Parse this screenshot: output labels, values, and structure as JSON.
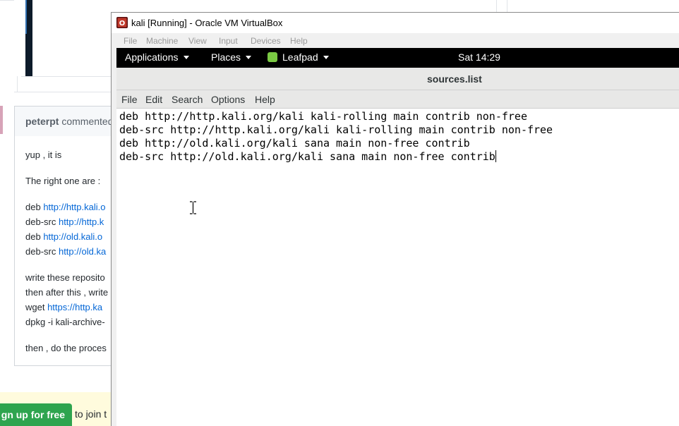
{
  "background_page": {
    "comment": {
      "author": "peterpt",
      "action": "commented",
      "lines": [
        {
          "text": "yup , it is",
          "link": ""
        },
        {
          "text": "The right one are :",
          "link": ""
        },
        {
          "text": "deb ",
          "link": "http://http.kali.o"
        },
        {
          "text": "deb-src ",
          "link": "http://http.k"
        },
        {
          "text": "deb ",
          "link": "http://old.kali.o"
        },
        {
          "text": "deb-src ",
          "link": "http://old.ka"
        },
        {
          "text": "write these reposito",
          "link": ""
        },
        {
          "text": "then after this , write",
          "link": ""
        },
        {
          "text": "wget ",
          "link": "https://http.ka"
        },
        {
          "text": "dpkg -i kali-archive-",
          "link": ""
        },
        {
          "text": "then , do the proces",
          "link": ""
        }
      ]
    },
    "signup": {
      "button_label": "gn up for free",
      "text": "to join t"
    }
  },
  "vbox": {
    "title": "kali [Running] - Oracle VM VirtualBox",
    "menu": [
      "File",
      "Machine",
      "View",
      "Input",
      "Devices",
      "Help"
    ]
  },
  "gnome_panel": {
    "applications_label": "Applications",
    "places_label": "Places",
    "app_label": "Leafpad",
    "clock": "Sat 14:29"
  },
  "leafpad": {
    "title": "sources.list",
    "menu": [
      "File",
      "Edit",
      "Search",
      "Options",
      "Help"
    ],
    "lines": [
      "deb http://http.kali.org/kali kali-rolling main contrib non-free",
      "deb-src http://http.kali.org/kali kali-rolling main contrib non-free",
      "deb http://old.kali.org/kali sana main non-free contrib",
      "deb-src http://old.kali.org/kali sana main non-free contrib"
    ]
  },
  "colors": {
    "link": "#0366d6",
    "signup_green": "#2ea44f",
    "panel_black": "#000000",
    "leafpad_green": "#7ac943"
  },
  "icons": [
    "virtualbox-icon",
    "leafpad-icon",
    "dropdown-arrow-icon",
    "text-cursor-icon"
  ]
}
